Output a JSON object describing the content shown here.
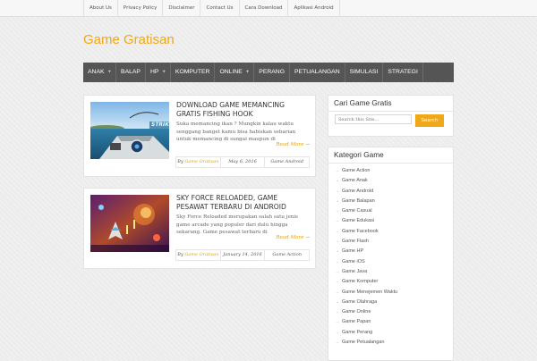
{
  "top_menu": [
    "About Us",
    "Privacy Policy",
    "Disclaimer",
    "Contact Us",
    "Cara Download",
    "Aplikasi Android"
  ],
  "site_title": "Game Gratisan",
  "main_nav": [
    {
      "label": "ANAK",
      "has_submenu": true
    },
    {
      "label": "BALAP",
      "has_submenu": false
    },
    {
      "label": "HP",
      "has_submenu": true
    },
    {
      "label": "KOMPUTER",
      "has_submenu": false
    },
    {
      "label": "ONLINE",
      "has_submenu": true
    },
    {
      "label": "PERANG",
      "has_submenu": false
    },
    {
      "label": "PETUALANGAN",
      "has_submenu": false
    },
    {
      "label": "SIMULASI",
      "has_submenu": false
    },
    {
      "label": "STRATEGI",
      "has_submenu": false
    }
  ],
  "submenu_marker": "+",
  "posts": [
    {
      "title": "DOWNLOAD GAME MEMANCING GRATIS FISHING HOOK",
      "excerpt": "Suka memancing ikan ? Mungkin kalau waktu senggang banget kamu bisa habiskan sebarian untuk memancing di sungai maupun di",
      "read_more": "Read More →",
      "meta": {
        "author_prefix": "By",
        "author": "Game Gratisan",
        "date": "May 6, 2016",
        "category": "Game Android"
      },
      "thumb_text": "STRIK"
    },
    {
      "title": "SKY FORCE RELOADED, GAME PESAWAT TERBARU DI ANDROID",
      "excerpt": "Sky Force Reloaded merupakan salah satu jenis game arcade yang populer dari dulu hingga sekarang. Game pesawat terbaru di",
      "read_more": "Read More →",
      "meta": {
        "author_prefix": "By",
        "author": "Game Gratisan",
        "date": "January 14, 2016",
        "category": "Game Action"
      }
    }
  ],
  "sidebar": {
    "search": {
      "title": "Cari Game Gratis",
      "placeholder": "Search this Site...",
      "button": "Search"
    },
    "categories": {
      "title": "Kategori Game",
      "arrow": "→",
      "items": [
        "Game Action",
        "Game Anak",
        "Game Android",
        "Game Balapan",
        "Game Casual",
        "Game Edukasi",
        "Game Facebook",
        "Game Flash",
        "Game HP",
        "Game iOS",
        "Game Java",
        "Game Komputer",
        "Game Menejemen Waktu",
        "Game Olahraga",
        "Game Online",
        "Game Papan",
        "Game Perang",
        "Game Petualangan"
      ]
    }
  },
  "colors": {
    "accent": "#f0a818",
    "nav_bg": "#555555",
    "page_bg": "#ececec"
  }
}
